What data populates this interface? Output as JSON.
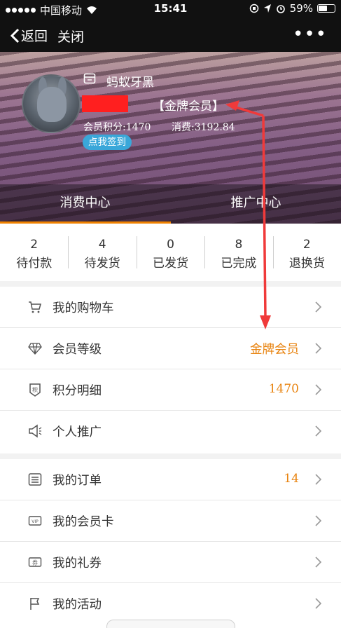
{
  "status": {
    "carrier": "中国移动",
    "time": "15:41",
    "battery": "59%",
    "battery_level": 0.59
  },
  "nav": {
    "back_label": "返回",
    "close_label": "关闭",
    "more_label": "•••"
  },
  "profile": {
    "username": "蚂蚁牙黑",
    "level_badge": "【金牌会员】",
    "points_text": "会员积分:1470",
    "spent_text": "消费:3192.84",
    "signin_label": "点我签到"
  },
  "tabs": [
    {
      "label": "消费中心",
      "active": true
    },
    {
      "label": "推广中心",
      "active": false
    }
  ],
  "accent_color": "#f08200",
  "stats": [
    {
      "count": "2",
      "label": "待付款"
    },
    {
      "count": "4",
      "label": "待发货"
    },
    {
      "count": "0",
      "label": "已发货"
    },
    {
      "count": "8",
      "label": "已完成"
    },
    {
      "count": "2",
      "label": "退换货"
    }
  ],
  "menu_group_1": [
    {
      "label": "我的购物车",
      "value": "",
      "icon": "cart-icon"
    },
    {
      "label": "会员等级",
      "value": "金牌会员",
      "icon": "diamond-icon"
    },
    {
      "label": "积分明细",
      "value": "1470",
      "icon": "points-icon"
    },
    {
      "label": "个人推广",
      "value": "",
      "icon": "megaphone-icon"
    }
  ],
  "menu_group_2": [
    {
      "label": "我的订单",
      "value": "14",
      "icon": "order-list-icon"
    },
    {
      "label": "我的会员卡",
      "value": "",
      "icon": "vip-card-icon"
    },
    {
      "label": "我的礼券",
      "value": "",
      "icon": "coupon-icon"
    },
    {
      "label": "我的活动",
      "value": "",
      "icon": "flag-icon"
    }
  ]
}
